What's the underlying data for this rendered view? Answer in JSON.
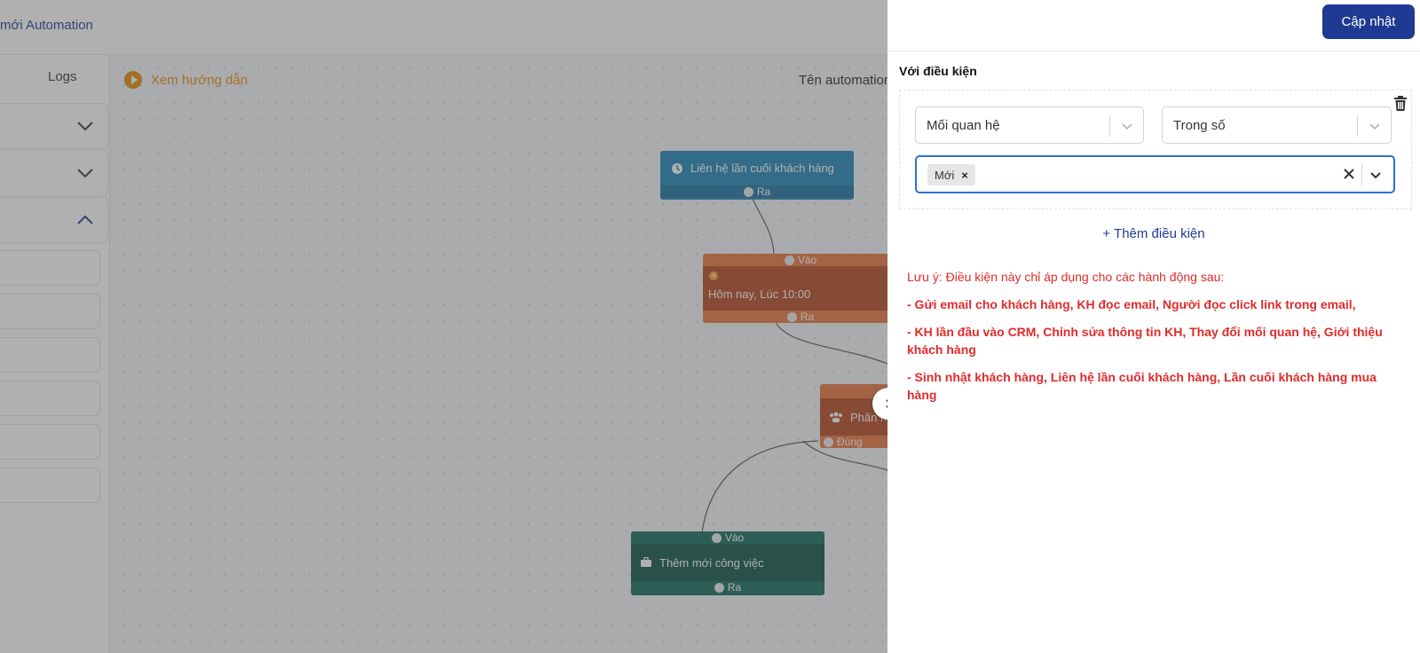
{
  "header": {
    "title": "mới Automation"
  },
  "left_panel": {
    "logs_tab": "Logs"
  },
  "toolbar": {
    "guide_label": "Xem hướng dẫn",
    "automation_name_label": "Tên automation"
  },
  "canvas": {
    "nodes": [
      {
        "title": "Liên hệ lần cuối khách hàng",
        "out": "Ra"
      },
      {
        "in": "Vào",
        "title": "Hôm nay, Lúc 10:00",
        "out": "Ra"
      },
      {
        "title": "Phân n",
        "out": "Đúng"
      },
      {
        "in": "Vào",
        "title": "Thêm mới công việc",
        "out": "Ra"
      }
    ]
  },
  "drawer": {
    "update_button": "Cập nhật",
    "condition_title": "Với điều kiện",
    "field_select": "Mối quan hệ",
    "operator_select": "Trong số",
    "selected_tag": "Mới",
    "add_condition": "+ Thêm điều kiện",
    "note_title": "Lưu ý: Điều kiện này chỉ áp dụng cho các hành động sau:",
    "note_lines": [
      "- Gửi email cho khách hàng, KH đọc email, Người đọc click link trong email,",
      "- KH lần đầu vào CRM, Chỉnh sửa thông tin KH, Thay đổi mối quan hệ, Giới thiệu khách hàng",
      "- Sinh nhật khách hàng, Liên hệ lần cuối khách hàng, Lần cuối khách hàng mua hàng"
    ]
  },
  "colors": {
    "primary": "#1f3a93",
    "accent_orange": "#e38b06",
    "node_blue": "#1a84b8",
    "node_orange": "#e8743b",
    "node_teal": "#0f6b5a",
    "warning_red": "#e02b2b"
  }
}
